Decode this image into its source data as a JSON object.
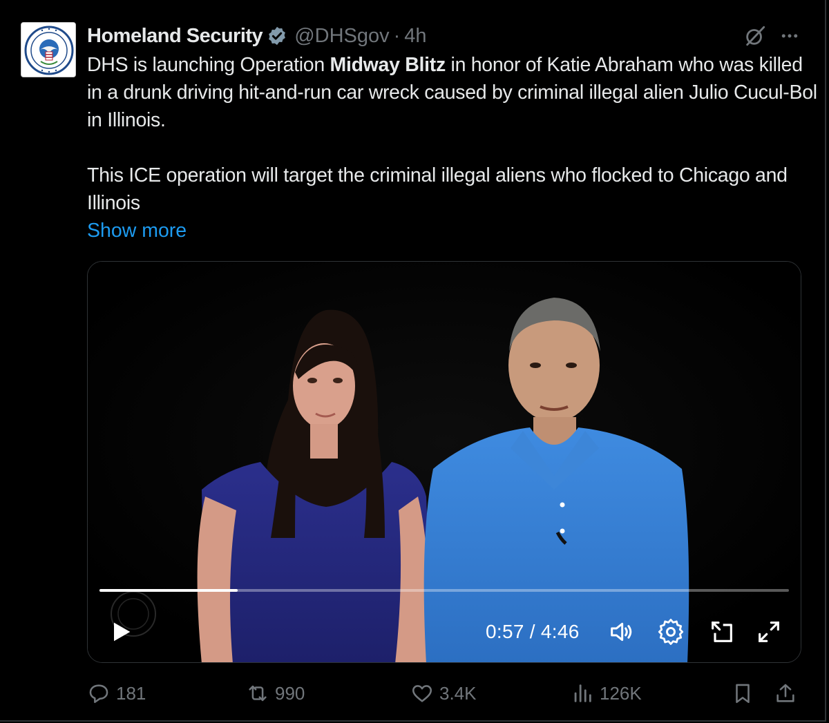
{
  "tweet": {
    "display_name": "Homeland Security",
    "handle": "@DHSgov",
    "separator": "·",
    "timestamp": "4h",
    "body": {
      "line1_before": "DHS is launching Operation ",
      "line1_bold": "Midway Blitz",
      "line1_after": " in honor of Katie Abraham who was killed in a drunk driving hit-and-run car wreck caused by criminal illegal alien Julio Cucul-Bol in Illinois.",
      "paragraph2": "This ICE operation will target the criminal illegal aliens who flocked to Chicago and Illinois"
    },
    "show_more": "Show more"
  },
  "video": {
    "current_time": "0:57",
    "duration": "4:46",
    "time_display": "0:57 / 4:46",
    "progress_fraction": 0.2
  },
  "actions": {
    "replies": "181",
    "reposts": "990",
    "likes": "3.4K",
    "views": "126K"
  },
  "icons": {
    "verified": "verified-badge-icon",
    "grok": "grok-icon",
    "more": "more-options-icon",
    "play": "play-icon",
    "volume": "volume-icon",
    "settings": "settings-gear-icon",
    "pip": "picture-in-picture-icon",
    "fullscreen": "fullscreen-icon",
    "reply": "reply-icon",
    "repost": "repost-icon",
    "like": "heart-icon",
    "views": "views-chart-icon",
    "bookmark": "bookmark-icon",
    "share": "share-icon"
  },
  "colors": {
    "background": "#000000",
    "text": "#e7e9ea",
    "muted": "#71767b",
    "link": "#1d9bf0",
    "verified": "#829aab"
  }
}
